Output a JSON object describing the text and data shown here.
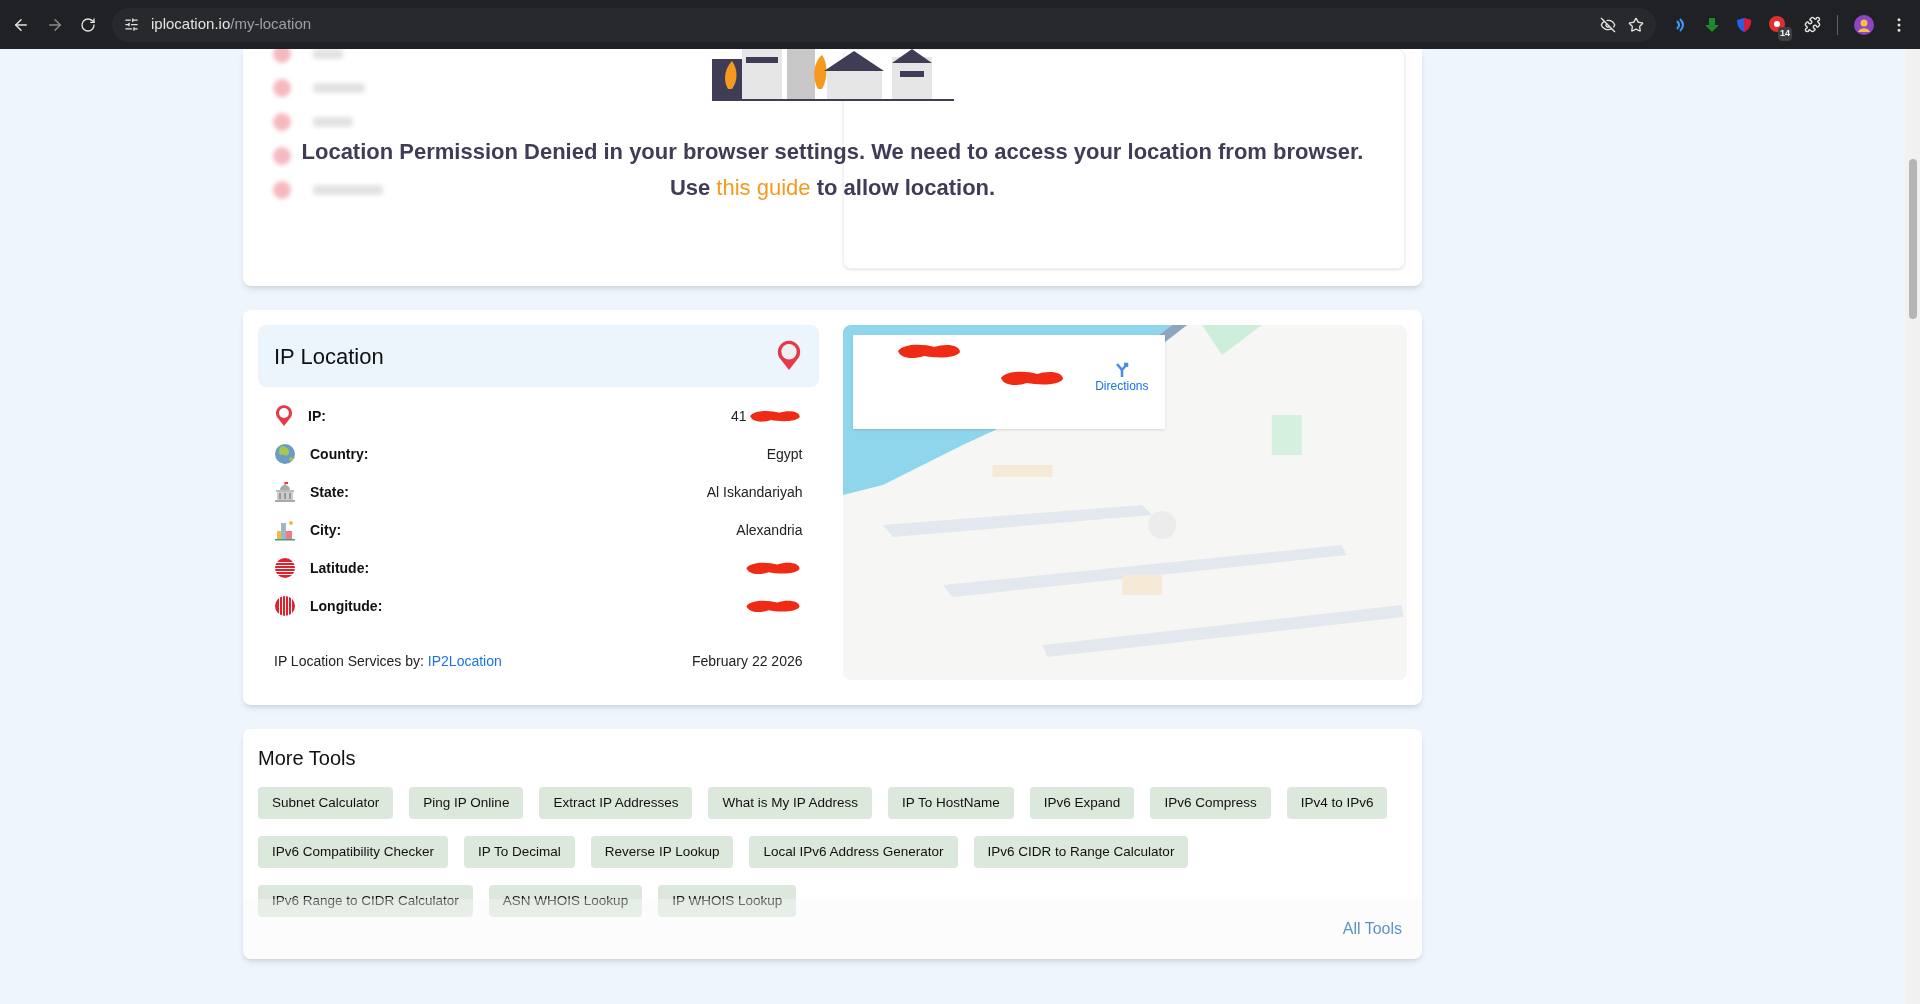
{
  "browser": {
    "url_host": "iplocation.io",
    "url_path": "/my-location",
    "extension_badge": "14"
  },
  "permission_card": {
    "message": "Location Permission Denied in your browser settings. We need to access your location from browser.",
    "message_prefix": "Use",
    "guide_link": "this guide",
    "message_suffix": "to allow location."
  },
  "ip_location": {
    "title": "IP Location",
    "rows": [
      {
        "kind": "ip",
        "label": "IP:",
        "value": "41",
        "redacted": true
      },
      {
        "kind": "globe",
        "label": "Country:",
        "value": "Egypt",
        "redacted": false
      },
      {
        "kind": "capitol",
        "label": "State:",
        "value": "Al Iskandariyah",
        "redacted": false
      },
      {
        "kind": "city",
        "label": "City:",
        "value": "Alexandria",
        "redacted": false
      },
      {
        "kind": "latitude",
        "label": "Latitude:",
        "redacted": true
      },
      {
        "kind": "longitude",
        "label": "Longitude:",
        "redacted": true
      }
    ],
    "footer_label": "IP Location Services by:",
    "footer_link": "IP2Location",
    "date": "February 22 2026",
    "map": {
      "kind": "picture",
      "directions": "Directions"
    }
  },
  "more_tools": {
    "title": "More Tools",
    "tools": [
      "Subnet Calculator",
      "Ping IP Online",
      "Extract IP Addresses",
      "What is My IP Address",
      "IP To HostName",
      "IPv6 Expand",
      "IPv6 Compress",
      "IPv4 to IPv6",
      "IPv6 Compatibility Checker",
      "IP To Decimal",
      "Reverse IP Lookup",
      "Local IPv6 Address Generator",
      "IPv6 CIDR to Range Calculator",
      "IPv6 Range to CIDR Calculator",
      "ASN WHOIS Lookup",
      "IP WHOIS Lookup"
    ],
    "all_tools": "All Tools"
  }
}
